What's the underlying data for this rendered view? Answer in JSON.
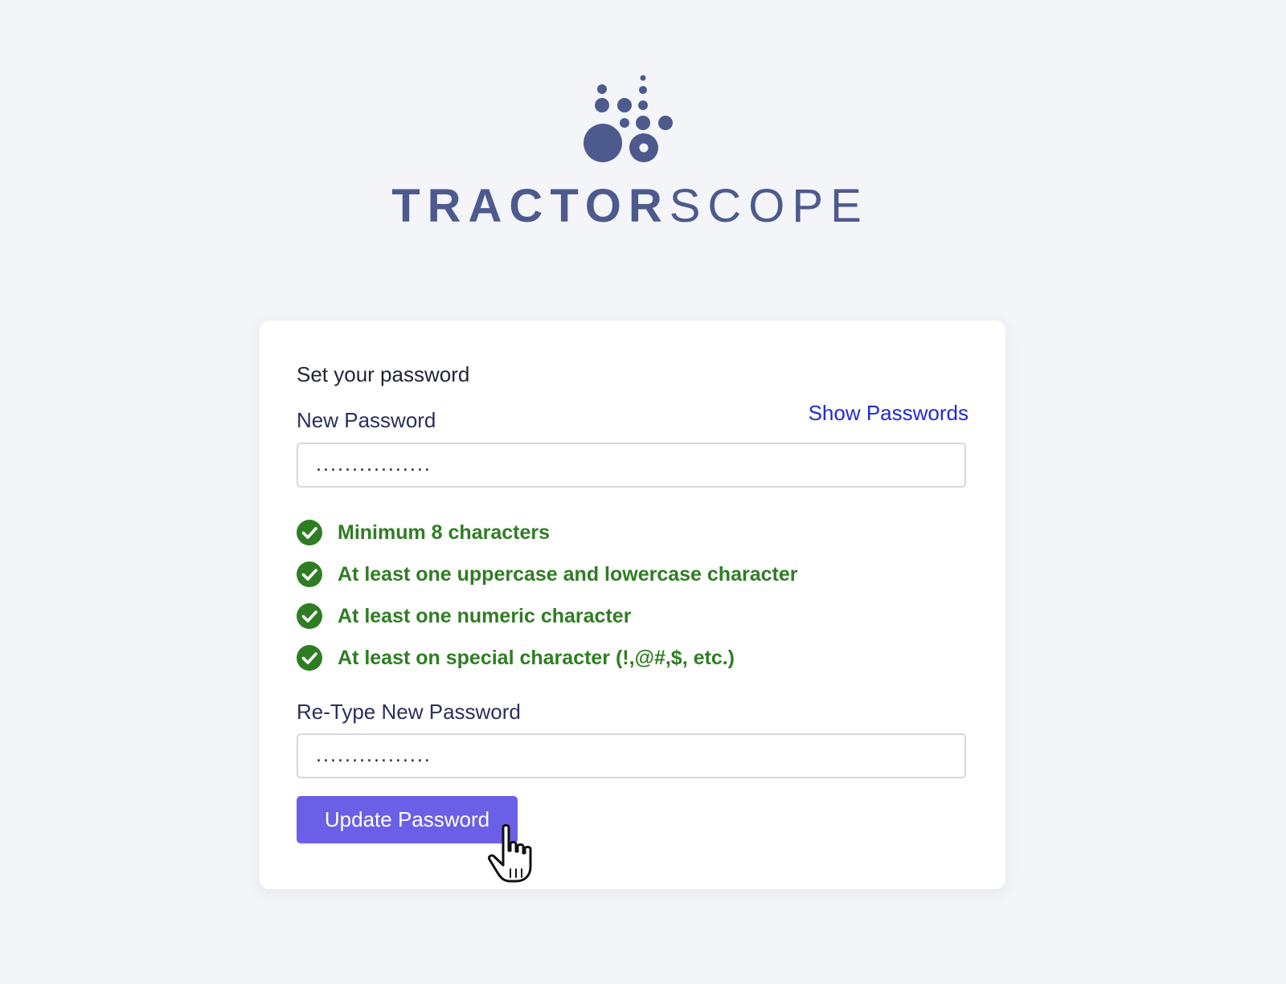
{
  "brand": {
    "name_strong": "TRACTOR",
    "name_light": "SCOPE",
    "color": "#4d5a8e"
  },
  "form": {
    "title": "Set your password",
    "new_password_label": "New Password",
    "show_passwords_label": "Show Passwords",
    "new_password_value": "................",
    "retype_label": "Re-Type New Password",
    "retype_value": "................",
    "submit_label": "Update Password"
  },
  "requirements": [
    {
      "text": "Minimum 8 characters",
      "status": "met"
    },
    {
      "text": "At least one uppercase and lowercase character",
      "status": "met"
    },
    {
      "text": "At least one numeric character",
      "status": "met"
    },
    {
      "text": "At least on special character (!,@#,$, etc.)",
      "status": "met"
    }
  ],
  "colors": {
    "background": "#f4f5f9",
    "accent": "#6a5fe6",
    "link": "#1d2bd6",
    "success": "#2f7d23"
  }
}
